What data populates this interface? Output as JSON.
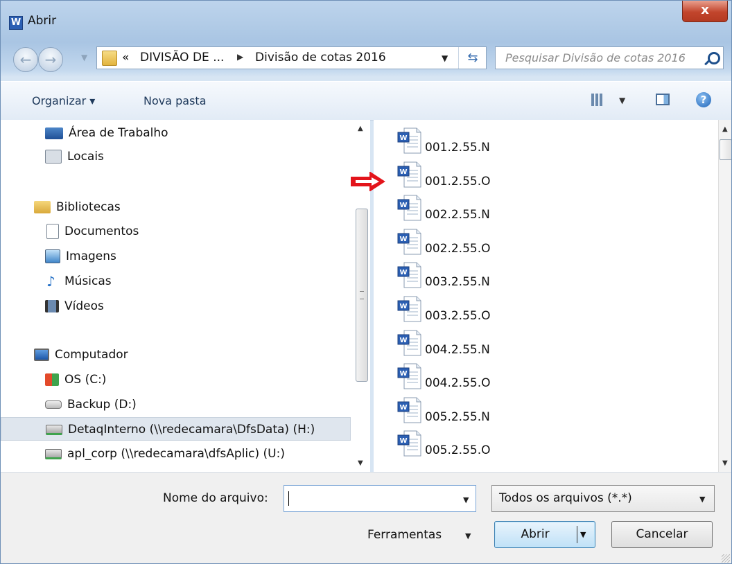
{
  "window": {
    "title": "Abrir",
    "app_icon": "W",
    "close_glyph": "x"
  },
  "navbar": {
    "breadcrumb_prefix": "«",
    "breadcrumb": [
      "DIVISÃO DE ...",
      "Divisão de cotas 2016"
    ],
    "search_placeholder": "Pesquisar Divisão de cotas 2016"
  },
  "toolbar": {
    "organize": "Organizar ▾",
    "new_folder": "Nova pasta"
  },
  "nav_pane": {
    "items": [
      {
        "label": "Área de Trabalho",
        "icon": "desktop-icon"
      },
      {
        "label": "Locais",
        "icon": "recent-places-icon"
      },
      {
        "label": "Bibliotecas",
        "icon": "libraries-icon"
      },
      {
        "label": "Documentos",
        "icon": "documents-icon"
      },
      {
        "label": "Imagens",
        "icon": "pictures-icon"
      },
      {
        "label": "Músicas",
        "icon": "music-icon"
      },
      {
        "label": "Vídeos",
        "icon": "videos-icon"
      },
      {
        "label": "Computador",
        "icon": "computer-icon"
      },
      {
        "label": "OS (C:)",
        "icon": "os-drive-icon"
      },
      {
        "label": "Backup (D:)",
        "icon": "drive-icon"
      },
      {
        "label": "DetaqInterno (\\\\redecamara\\DfsData) (H:)",
        "icon": "network-drive-icon",
        "selected": true
      },
      {
        "label": "apl_corp (\\\\redecamara\\dfsAplic) (U:)",
        "icon": "network-drive-icon"
      }
    ]
  },
  "files": [
    "001.2.55.N",
    "001.2.55.O",
    "002.2.55.N",
    "002.2.55.O",
    "003.2.55.N",
    "003.2.55.O",
    "004.2.55.N",
    "004.2.55.O",
    "005.2.55.N",
    "005.2.55.O"
  ],
  "bottom": {
    "filename_label": "Nome do arquivo:",
    "filename_value": "",
    "filter_value": "Todos os arquivos (*.*)",
    "tools_label": "Ferramentas",
    "open_button": "Abrir",
    "cancel_button": "Cancelar"
  },
  "colors": {
    "accent": "#3c7fb1",
    "arrow": "#e3141b",
    "word_blue": "#2b5fb3"
  }
}
